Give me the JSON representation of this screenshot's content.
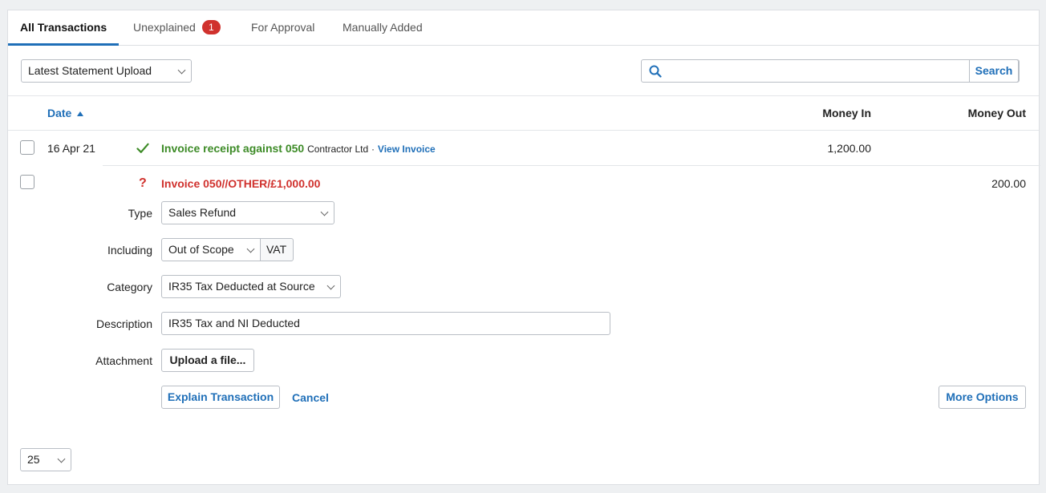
{
  "tabs": {
    "all": "All Transactions",
    "unexplained": "Unexplained",
    "unexplained_count": "1",
    "approval": "For Approval",
    "manual": "Manually Added"
  },
  "filter": {
    "selected": "Latest Statement Upload"
  },
  "search": {
    "value": "",
    "button": "Search"
  },
  "table": {
    "col_date": "Date",
    "col_money_in": "Money In",
    "col_money_out": "Money Out"
  },
  "rows": [
    {
      "date": "16 Apr 21",
      "title": "Invoice receipt against 050",
      "contact": "Contractor Ltd",
      "separator": "·",
      "link": "View Invoice",
      "money_in": "1,200.00",
      "money_out": ""
    },
    {
      "date": "",
      "title": "Invoice 050//OTHER/£1,000.00",
      "money_in": "",
      "money_out": "200.00"
    }
  ],
  "form": {
    "type_label": "Type",
    "type_value": "Sales Refund",
    "including_label": "Including",
    "including_value": "Out of Scope",
    "vat_label": "VAT",
    "category_label": "Category",
    "category_value": "IR35 Tax Deducted at Source",
    "description_label": "Description",
    "description_value": "IR35 Tax and NI Deducted",
    "attachment_label": "Attachment",
    "upload_button": "Upload a file...",
    "explain_button": "Explain Transaction",
    "cancel_link": "Cancel",
    "more_options_button": "More Options"
  },
  "pagination": {
    "per_page": "25"
  },
  "colors": {
    "accent": "#1f6fb8",
    "success": "#3d8b27",
    "danger": "#d0312d"
  },
  "icons": {
    "check": "check-icon",
    "question": "question-icon",
    "search": "search-icon",
    "sort": "sort-asc-icon"
  }
}
